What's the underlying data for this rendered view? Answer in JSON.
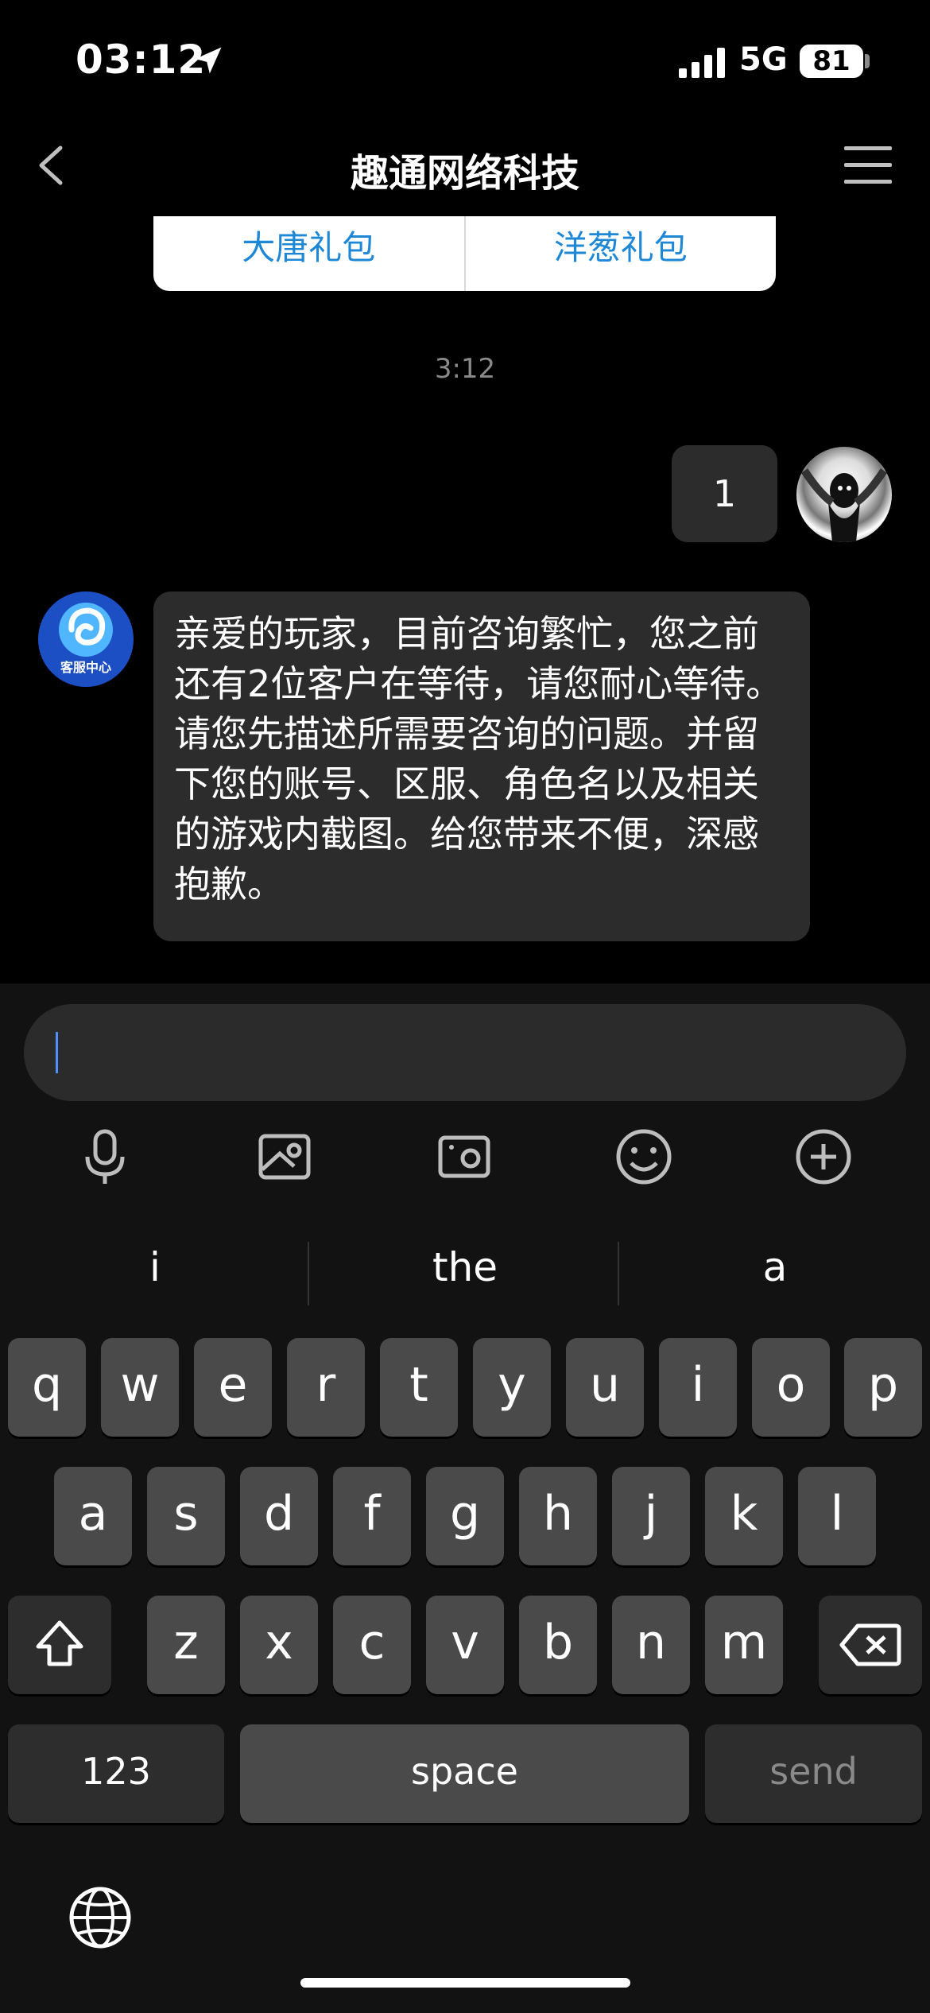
{
  "status_bar": {
    "time": "03:12",
    "network": "5G",
    "battery": "81"
  },
  "nav": {
    "title": "趣通网络科技"
  },
  "gift_card": {
    "left_label": "大唐礼包",
    "right_label": "洋葱礼包"
  },
  "messages": {
    "timestamp": "3:12",
    "outgoing": {
      "text": "1"
    },
    "incoming": {
      "avatar_label": "客服中心",
      "text": "亲爱的玩家，目前咨询繁忙，您之前还有2位客户在等待，请您耐心等待。请您先描述所需要咨询的问题。并留下您的账号、区服、角色名以及相关的游戏内截图。给您带来不便，深感抱歉。"
    }
  },
  "input": {
    "value": ""
  },
  "tools": [
    "microphone-icon",
    "photo-icon",
    "camera-icon",
    "emoji-icon",
    "plus-icon"
  ],
  "keyboard": {
    "suggestions": [
      "i",
      "the",
      "a"
    ],
    "row1": [
      "q",
      "w",
      "e",
      "r",
      "t",
      "y",
      "u",
      "i",
      "o",
      "p"
    ],
    "row2": [
      "a",
      "s",
      "d",
      "f",
      "g",
      "h",
      "j",
      "k",
      "l"
    ],
    "row3": [
      "z",
      "x",
      "c",
      "v",
      "b",
      "n",
      "m"
    ],
    "numbers_label": "123",
    "space_label": "space",
    "send_label": "send"
  }
}
